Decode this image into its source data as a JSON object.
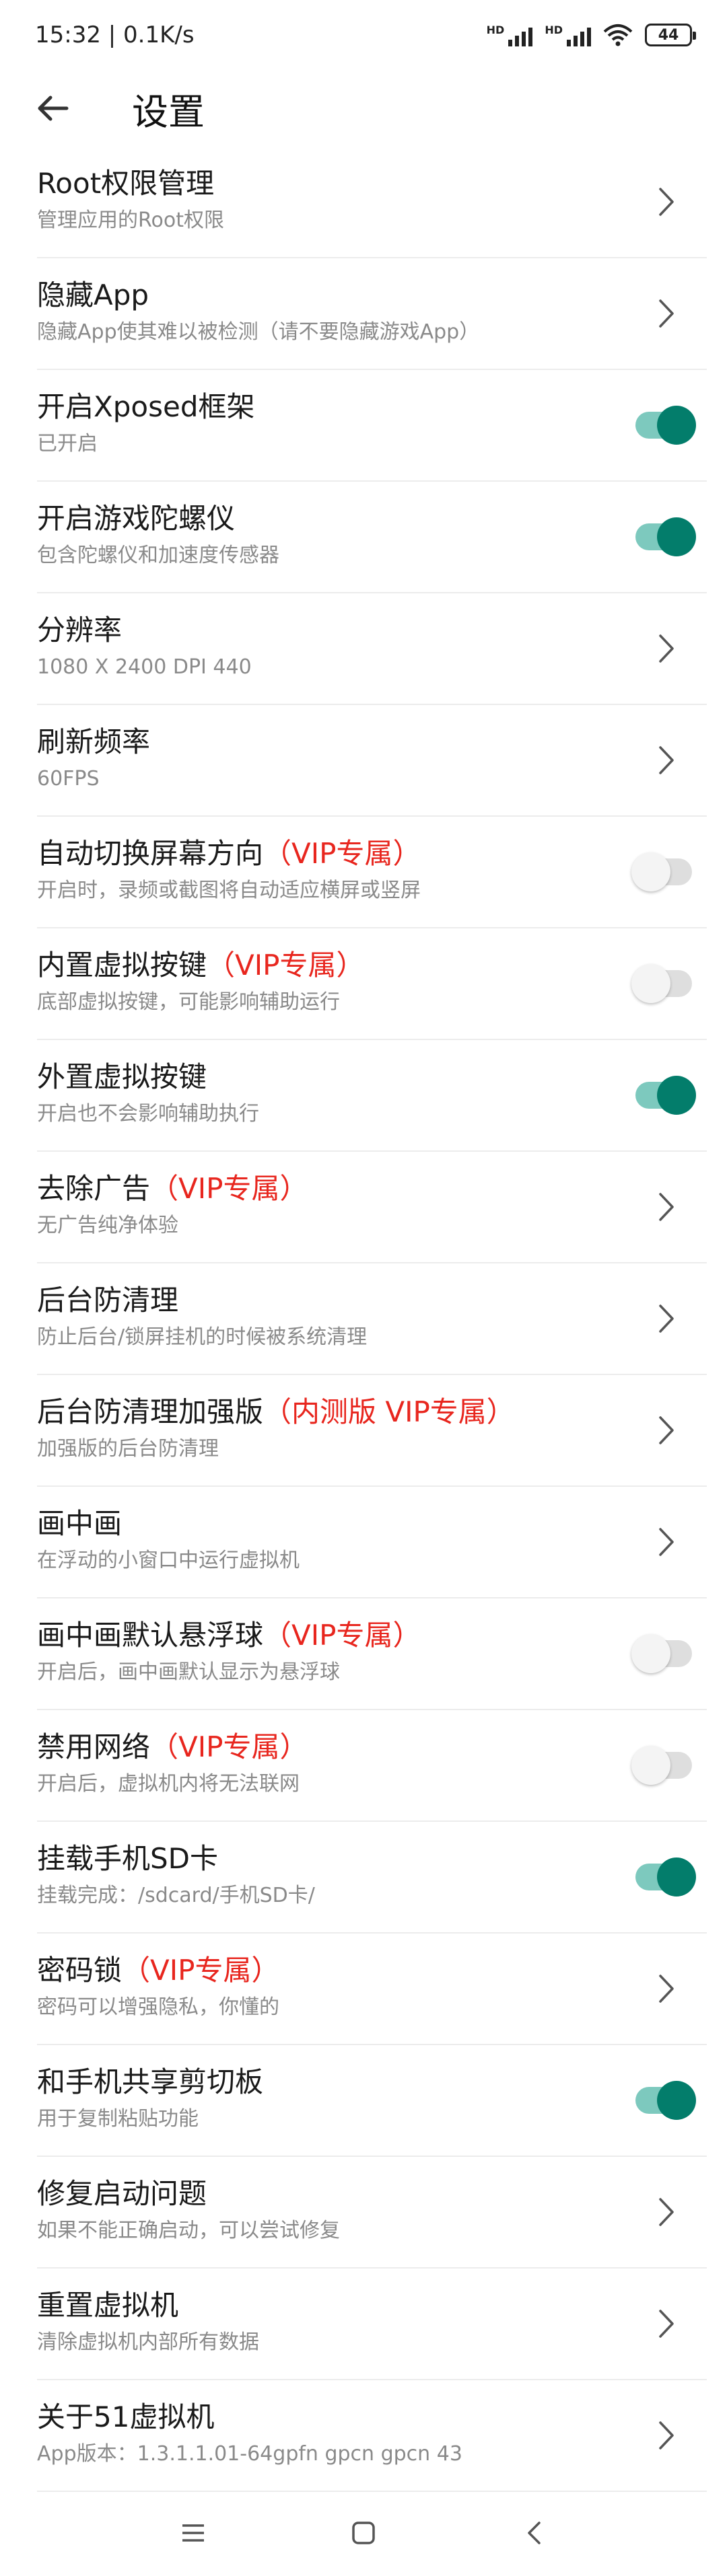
{
  "status_bar": {
    "time_speed": "15:32 | 0.1K/s",
    "hd_label": "HD",
    "battery": "44",
    "icons": [
      "signal-icon",
      "signal-icon",
      "wifi-icon",
      "battery-icon"
    ]
  },
  "header": {
    "back_icon": "arrow-left-icon",
    "title": "设置"
  },
  "settings": [
    {
      "title": "Root权限管理",
      "vip": "",
      "subtitle": "管理应用的Root权限",
      "control": "chevron"
    },
    {
      "title": "隐藏App",
      "vip": "",
      "subtitle": "隐藏App使其难以被检测（请不要隐藏游戏App）",
      "control": "chevron"
    },
    {
      "title": "开启Xposed框架",
      "vip": "",
      "subtitle": "已开启",
      "control": "toggle",
      "on": true
    },
    {
      "title": "开启游戏陀螺仪",
      "vip": "",
      "subtitle": "包含陀螺仪和加速度传感器",
      "control": "toggle",
      "on": true
    },
    {
      "title": "分辨率",
      "vip": "",
      "subtitle": "1080 X 2400 DPI 440",
      "control": "chevron"
    },
    {
      "title": "刷新频率",
      "vip": "",
      "subtitle": "60FPS",
      "control": "chevron"
    },
    {
      "title": "自动切换屏幕方向",
      "vip": "（VIP专属）",
      "subtitle": "开启时，录频或截图将自动适应横屏或竖屏",
      "control": "toggle",
      "on": false
    },
    {
      "title": "内置虚拟按键",
      "vip": "（VIP专属）",
      "subtitle": "底部虚拟按键，可能影响辅助运行",
      "control": "toggle",
      "on": false
    },
    {
      "title": "外置虚拟按键",
      "vip": "",
      "subtitle": "开启也不会影响辅助执行",
      "control": "toggle",
      "on": true
    },
    {
      "title": "去除广告",
      "vip": "（VIP专属）",
      "subtitle": "无广告纯净体验",
      "control": "chevron"
    },
    {
      "title": "后台防清理",
      "vip": "",
      "subtitle": "防止后台/锁屏挂机的时候被系统清理",
      "control": "chevron"
    },
    {
      "title": "后台防清理加强版",
      "vip": "（内测版 VIP专属）",
      "subtitle": "加强版的后台防清理",
      "control": "chevron"
    },
    {
      "title": "画中画",
      "vip": "",
      "subtitle": "在浮动的小窗口中运行虚拟机",
      "control": "chevron"
    },
    {
      "title": "画中画默认悬浮球",
      "vip": "（VIP专属）",
      "subtitle": "开启后，画中画默认显示为悬浮球",
      "control": "toggle",
      "on": false
    },
    {
      "title": "禁用网络",
      "vip": "（VIP专属）",
      "subtitle": "开启后，虚拟机内将无法联网",
      "control": "toggle",
      "on": false
    },
    {
      "title": "挂载手机SD卡",
      "vip": "",
      "subtitle": "挂载完成：/sdcard/手机SD卡/",
      "control": "toggle",
      "on": true
    },
    {
      "title": "密码锁",
      "vip": "（VIP专属）",
      "subtitle": "密码可以增强隐私，你懂的",
      "control": "chevron"
    },
    {
      "title": "和手机共享剪切板",
      "vip": "",
      "subtitle": "用于复制粘贴功能",
      "control": "toggle",
      "on": true
    },
    {
      "title": "修复启动问题",
      "vip": "",
      "subtitle": "如果不能正确启动，可以尝试修复",
      "control": "chevron"
    },
    {
      "title": "重置虚拟机",
      "vip": "",
      "subtitle": "清除虚拟机内部所有数据",
      "control": "chevron"
    },
    {
      "title": "关于51虚拟机",
      "vip": "",
      "subtitle": "App版本：1.3.1.1.01-64gpfn gpcn gpcn 43",
      "control": "chevron"
    }
  ],
  "nav_bar": {
    "icons": [
      "menu-icon",
      "home-square-icon",
      "back-chevron-icon"
    ]
  },
  "colors": {
    "vip_text": "#e8261e",
    "toggle_on_knob": "#037d6b",
    "toggle_on_track": "#7dc9be",
    "toggle_off_track": "#dedede",
    "subtitle": "#8a8a8a"
  }
}
